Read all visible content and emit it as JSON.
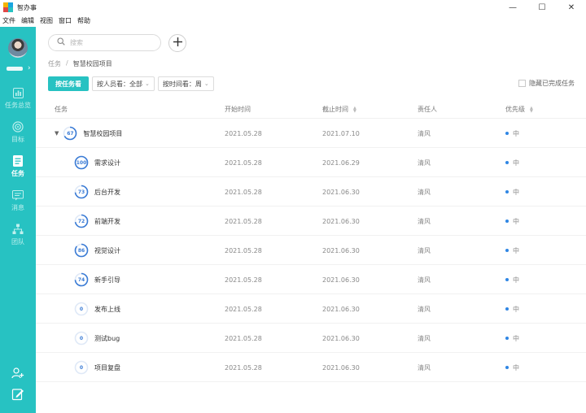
{
  "app": {
    "title": "智办事"
  },
  "window": {
    "minimize": "—",
    "maximize": "☐",
    "close": "✕"
  },
  "menu": [
    "文件",
    "编辑",
    "视图",
    "窗口",
    "帮助"
  ],
  "sidebar": {
    "nav": [
      {
        "key": "overview",
        "label": "任务总览",
        "icon": "chart-icon",
        "active": false
      },
      {
        "key": "goal",
        "label": "目标",
        "icon": "target-icon",
        "active": false
      },
      {
        "key": "task",
        "label": "任务",
        "icon": "task-list-icon",
        "active": true
      },
      {
        "key": "message",
        "label": "消息",
        "icon": "message-icon",
        "active": false
      },
      {
        "key": "team",
        "label": "团队",
        "icon": "team-icon",
        "active": false
      }
    ]
  },
  "search": {
    "placeholder": "搜索"
  },
  "breadcrumb": {
    "root": "任务",
    "sep": "/",
    "current": "智慧校园项目"
  },
  "filters": {
    "by_task": "按任务看",
    "by_member": "按人员看：全部",
    "by_time": "按时间看：周"
  },
  "hide_completed": "隐藏已完成任务",
  "table": {
    "headers": {
      "task": "任务",
      "start": "开始时间",
      "end": "截止时间",
      "owner": "责任人",
      "priority": "优先级"
    },
    "rows": [
      {
        "progress": 67,
        "name": "智慧校园项目",
        "start": "2021.05.28",
        "end": "2021.07.10",
        "owner": "清风",
        "priority": "中",
        "parent": true
      },
      {
        "progress": 100,
        "name": "需求设计",
        "start": "2021.05.28",
        "end": "2021.06.29",
        "owner": "清风",
        "priority": "中",
        "parent": false
      },
      {
        "progress": 73,
        "name": "后台开发",
        "start": "2021.05.28",
        "end": "2021.06.30",
        "owner": "清风",
        "priority": "中",
        "parent": false
      },
      {
        "progress": 72,
        "name": "前端开发",
        "start": "2021.05.28",
        "end": "2021.06.30",
        "owner": "清风",
        "priority": "中",
        "parent": false
      },
      {
        "progress": 86,
        "name": "视觉设计",
        "start": "2021.05.28",
        "end": "2021.06.30",
        "owner": "清风",
        "priority": "中",
        "parent": false
      },
      {
        "progress": 74,
        "name": "新手引导",
        "start": "2021.05.28",
        "end": "2021.06.30",
        "owner": "清风",
        "priority": "中",
        "parent": false
      },
      {
        "progress": 0,
        "name": "发布上线",
        "start": "2021.05.28",
        "end": "2021.06.30",
        "owner": "清风",
        "priority": "中",
        "parent": false
      },
      {
        "progress": 0,
        "name": "测试bug",
        "start": "2021.05.28",
        "end": "2021.06.30",
        "owner": "清风",
        "priority": "中",
        "parent": false
      },
      {
        "progress": 0,
        "name": "项目复盘",
        "start": "2021.05.28",
        "end": "2021.06.30",
        "owner": "清风",
        "priority": "中",
        "parent": false
      }
    ]
  },
  "colors": {
    "accent": "#27c2c2",
    "ring": "#3a7bd5",
    "ring_track": "#dfe9f7",
    "priority_dot": "#2f86e4"
  }
}
